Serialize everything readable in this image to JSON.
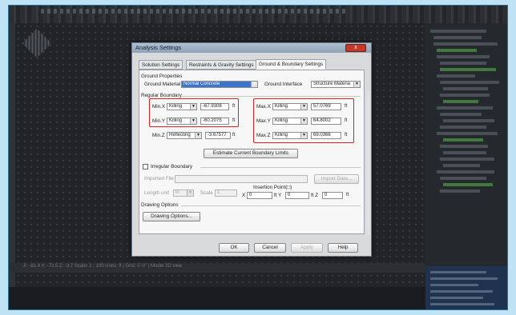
{
  "dialog": {
    "title": "Analysis Settings",
    "close_glyph": "x",
    "tabs": [
      "Solution Settings",
      "Restraints & Gravity Settings",
      "Ground & Boundary Settings"
    ],
    "ground_properties": {
      "section_label": "Ground Properties",
      "material_label": "Ground Material",
      "material_value": "Normal Concrete",
      "interface_label": "Ground Interface",
      "interface_value": "Structure Materia"
    },
    "regular_boundary": {
      "section_label": "Regular Boundary",
      "min_x": {
        "label": "Min.X",
        "type": "Killing",
        "value": "-67.9308",
        "unit": "ft"
      },
      "min_y": {
        "label": "Min.Y",
        "type": "Killing",
        "value": "-60.2075",
        "unit": "ft"
      },
      "min_z": {
        "label": "Min.Z",
        "type": "Reflecting",
        "value": "-3.67577",
        "unit": "ft"
      },
      "max_x": {
        "label": "Max.X",
        "type": "Killing",
        "value": "57.0769",
        "unit": "ft"
      },
      "max_y": {
        "label": "Max.Y",
        "type": "Killing",
        "value": "64.8002",
        "unit": "ft"
      },
      "max_z": {
        "label": "Max.Z",
        "type": "Killing",
        "value": "69.0366",
        "unit": "ft"
      },
      "estimate_button": "Estimate Current Boundary Limits"
    },
    "irregular_boundary": {
      "checkbox_label": "Irregular Boundary",
      "imported_file_label": "Imported File",
      "import_button": "Import Data...",
      "length_unit_label": "Length unit",
      "length_unit_value": "in",
      "scale_label": "Scale",
      "scale_value": "1",
      "insertion_point_label": "Insertion Point(□)",
      "x_label": "X",
      "x_value": "0",
      "y_label": "ft  Y",
      "y_value": "0",
      "z_label": "ft  Z",
      "z_value": "0",
      "z_unit": "ft"
    },
    "drawing_options": {
      "section_label": "Drawing Options",
      "button": "Drawing Options..."
    },
    "footer": {
      "ok": "OK",
      "cancel": "Cancel",
      "apply": "Apply",
      "help": "Help"
    }
  },
  "background": {
    "status_text": "X: -81.4    Y: -72.5    Z: -3.7    Scale: 1 : 100   Units: ft   |   Grid: 5'-0\"   |   Model 3D view"
  },
  "colors": {
    "highlight_box": "#e02020",
    "selected_combo": "#3b74c9",
    "close_button": "#c0392b"
  }
}
